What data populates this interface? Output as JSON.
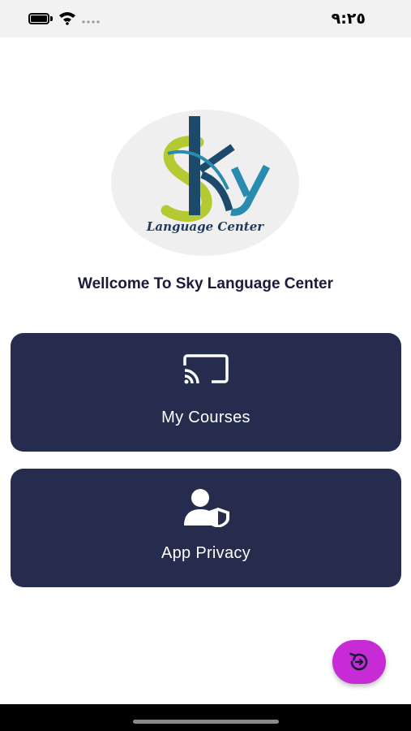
{
  "status_bar": {
    "time": "٩:٢٥",
    "icons": [
      "battery-icon",
      "wifi-icon",
      "signal-dots-icon"
    ]
  },
  "logo": {
    "brand": "Sky",
    "caption": "Language Center",
    "colors": {
      "s_lime": "#b5c932",
      "k_navy": "#1d4a6b",
      "y_teal": "#2a8bb0"
    }
  },
  "welcome": {
    "text": "Wellcome To Sky Language Center"
  },
  "menu": {
    "items": [
      {
        "label": "My Courses",
        "icon": "cast-icon"
      },
      {
        "label": "App Privacy",
        "icon": "user-shield-icon"
      }
    ]
  },
  "fab": {
    "icon": "refresh-arrow-icon",
    "color": "#c72bd6"
  },
  "theme": {
    "card_bg": "#252c4d",
    "text_dark": "#1a1a3a"
  }
}
